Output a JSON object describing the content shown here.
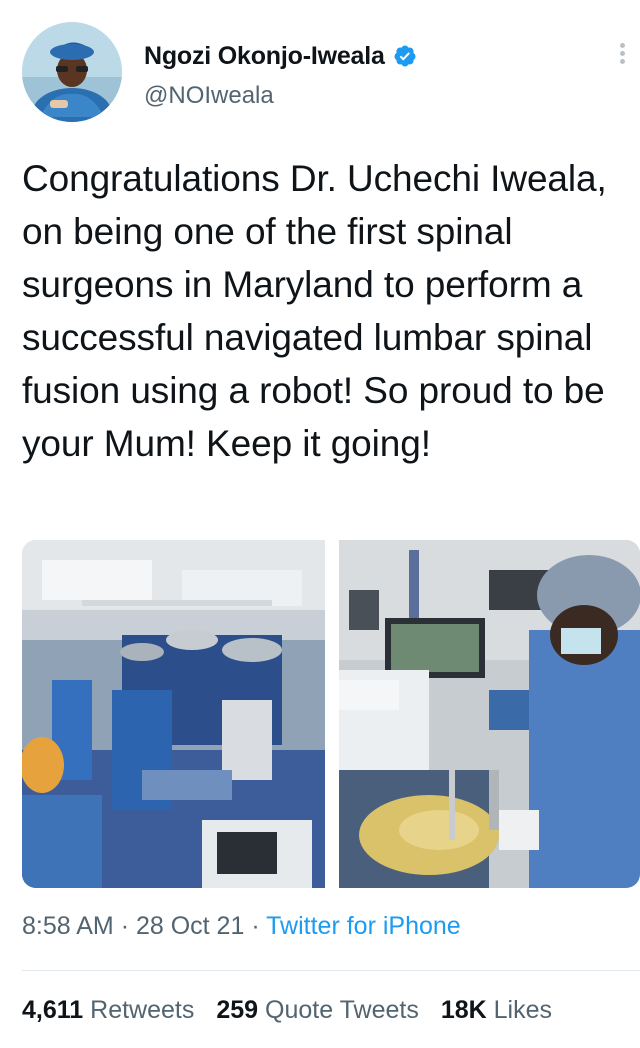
{
  "author": {
    "display_name": "Ngozi Okonjo-Iweala",
    "handle": "@NOIweala",
    "verified": true
  },
  "tweet": {
    "text": "Congratulations Dr. Uchechi Iweala, on being one of the first spinal surgeons in Maryland to perform a successful navigated lumbar spinal fusion using a robot! So proud to be your Mum! Keep it going!"
  },
  "meta": {
    "time": "8:58 AM",
    "separator": "·",
    "date": "28 Oct 21",
    "source": "Twitter for iPhone"
  },
  "stats": {
    "retweets_count": "4,611",
    "retweets_label": "Retweets",
    "quotes_count": "259",
    "quotes_label": "Quote Tweets",
    "likes_count": "18K",
    "likes_label": "Likes"
  },
  "colors": {
    "accent": "#1d9bf0",
    "secondary_text": "#536471",
    "primary_text": "#0f1419"
  },
  "icons": {
    "verified": "verified-badge-icon",
    "more": "more-options-icon"
  }
}
